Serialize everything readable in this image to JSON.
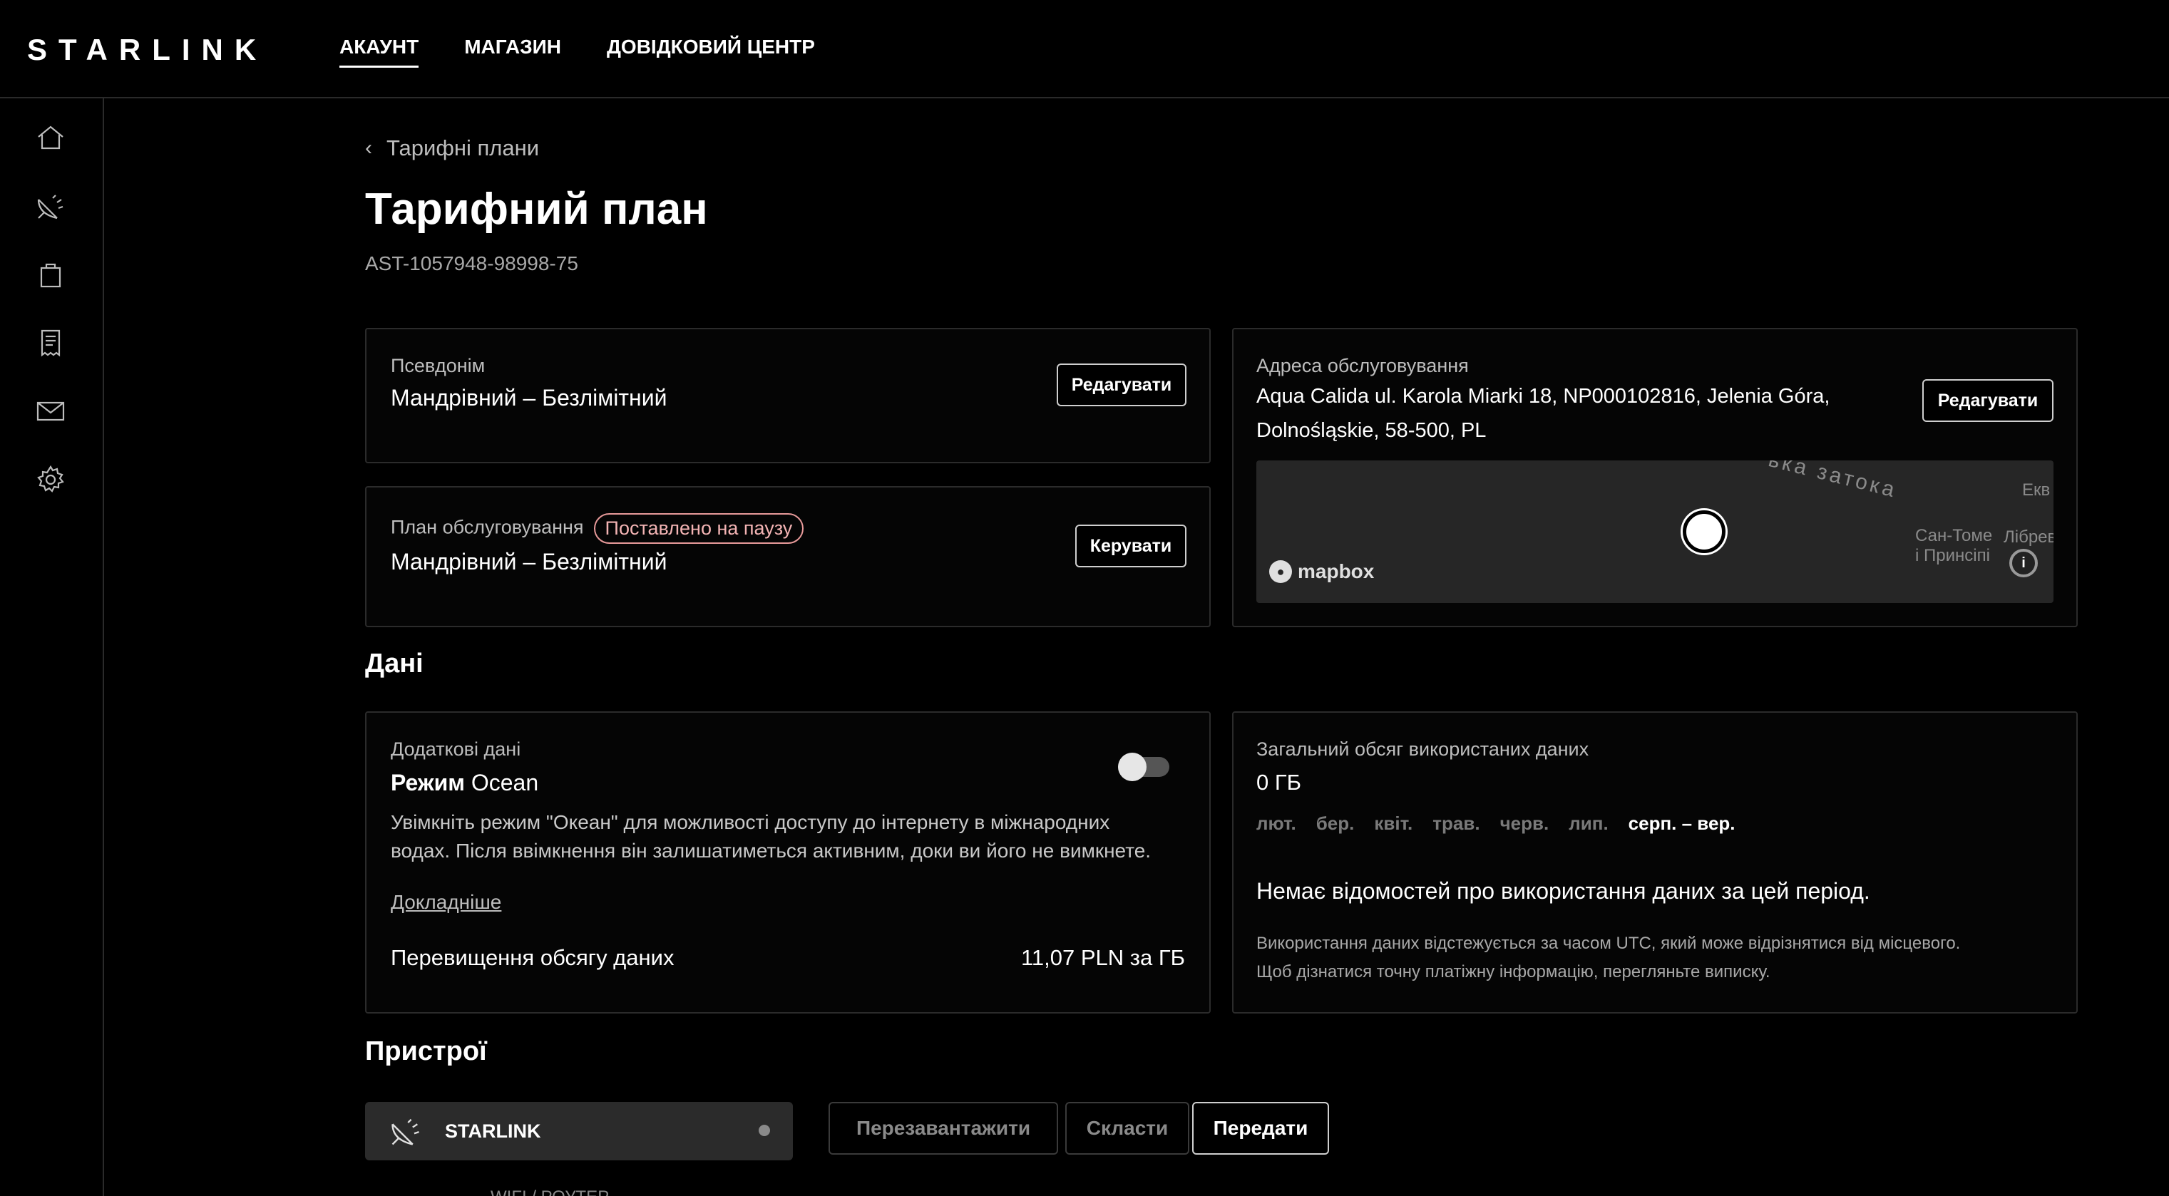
{
  "brand": "STARLINK",
  "nav": {
    "items": [
      "АКАУНТ",
      "МАГАЗИН",
      "ДОВІДКОВИЙ ЦЕНТР"
    ]
  },
  "sidebar": {
    "icons": [
      "home-icon",
      "dish-icon",
      "shopping-bag-icon",
      "receipt-icon",
      "mail-icon",
      "gear-icon"
    ]
  },
  "breadcrumb": "Тарифні плани",
  "page": {
    "title": "Тарифний план",
    "id": "AST-1057948-98998-75"
  },
  "nickname_card": {
    "label": "Псевдонім",
    "value": "Мандрівний – Безлімітний",
    "button": "Редагувати"
  },
  "service_plan_card": {
    "label": "План обслуговування",
    "badge": "Поставлено на паузу",
    "value": "Мандрівний – Безлімітний",
    "button": "Керувати"
  },
  "address_card": {
    "label": "Адреса обслуговування",
    "line1": "Aqua Calida ul. Karola Miarki 18, NP000102816, Jelenia Góra,",
    "line2": "Dolnośląskie, 58-500, PL",
    "button": "Редагувати",
    "map": {
      "arc_label": "ька затока",
      "label1": "Екв",
      "label2": "Сан-Томе",
      "label3": "і Принсіпі",
      "label4": "Лібрев",
      "attribution": "mapbox",
      "info": "i"
    }
  },
  "data_section": {
    "title": "Дані"
  },
  "extra_data_card": {
    "label": "Додаткові дані",
    "mode_prefix": "Режим",
    "mode_name": "Ocean",
    "toggle_on": false,
    "desc1": "Увімкніть режим \"Океан\" для можливості доступу до інтернету в міжнародних",
    "desc2": "водах. Після ввімкнення він залишатиметься активним, доки ви його не вимкнете.",
    "more_link": "Докладніше",
    "overage_label": "Перевищення обсягу даних",
    "overage_value": "11,07 PLN за ГБ"
  },
  "usage_card": {
    "label": "Загальний обсяг використаних даних",
    "value": "0 ГБ",
    "months": [
      "лют.",
      "бер.",
      "квіт.",
      "трав.",
      "черв.",
      "лип."
    ],
    "active_month": "серп. – вер.",
    "empty_text": "Немає відомостей про використання даних за цей період.",
    "note1": "Використання даних відстежується за часом UTC, який може відрізнятися від місцевого.",
    "note2": "Щоб дізнатися точну платіжну інформацію, перегляньте виписку."
  },
  "devices_section": {
    "title": "Пристрої",
    "device_name": "STARLINK",
    "next_device": "WIFI / РОУТЕР",
    "actions": {
      "restart": "Перезавантажити",
      "stow": "Скласти",
      "transfer": "Передати"
    }
  },
  "colors": {
    "background": "#000000",
    "badge": "#e89a9a",
    "card_border": "#2b2b2b"
  }
}
